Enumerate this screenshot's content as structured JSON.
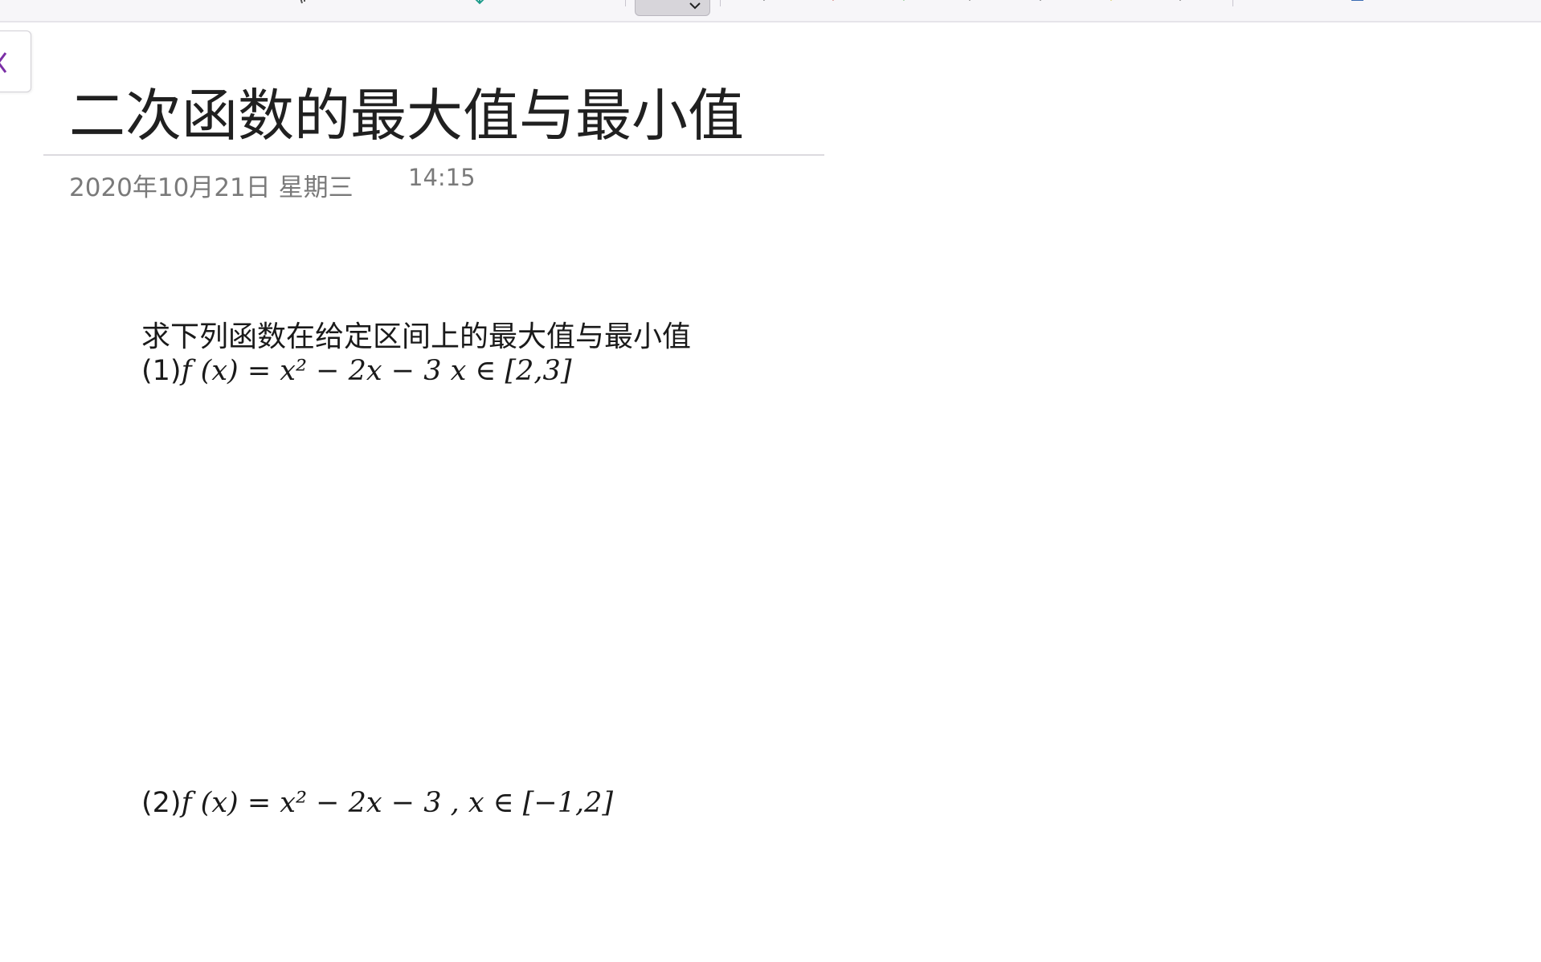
{
  "page": {
    "title": "二次函数的最大值与最小值",
    "date": "2020年10月21日 星期三",
    "time": "14:15"
  },
  "content": {
    "instruction": "求下列函数在给定区间上的最大值与最小值",
    "problems": [
      {
        "number": "(1)",
        "expression": "f (x) = x² − 2x − 3  x ∈ [2,3]"
      },
      {
        "number": "(2)",
        "expression": "f (x) = x² − 2x − 3 , x ∈ [−1,2]"
      }
    ]
  },
  "colors": {
    "accent": "#7b2fa6",
    "teal": "#1f9c8c",
    "red": "#c0392b",
    "green": "#4caf50",
    "yellow": "#c8b400"
  },
  "icons": {
    "back": "chevron-left-icon",
    "dropdown": "chevron-down-icon"
  }
}
